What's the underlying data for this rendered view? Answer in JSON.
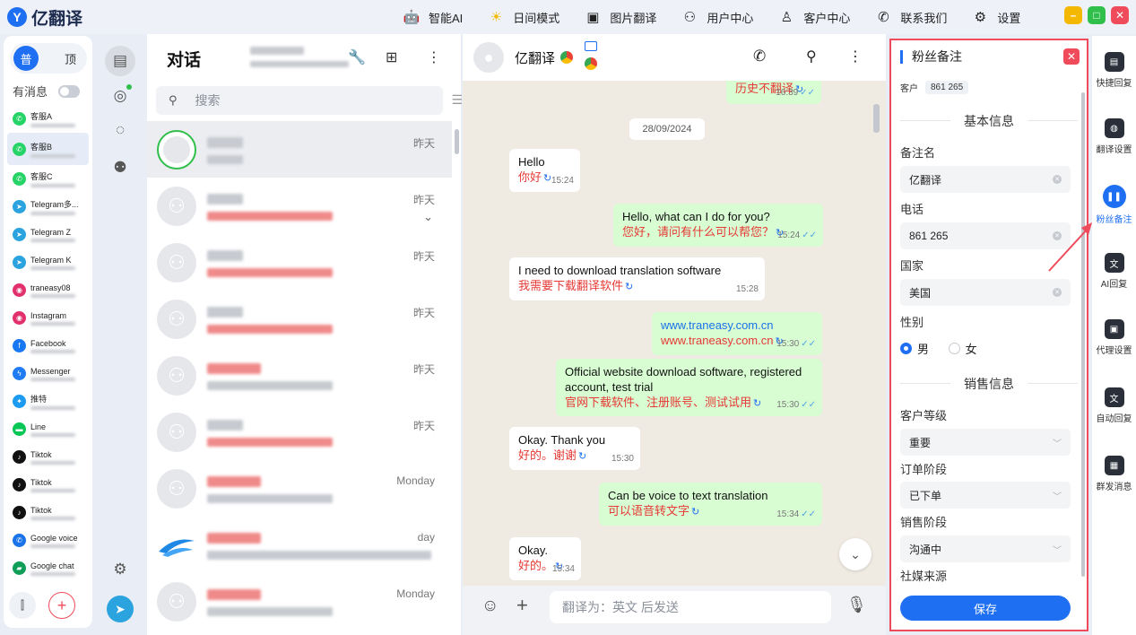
{
  "app": {
    "name": "亿翻译",
    "nav": [
      {
        "label": "智能AI",
        "icon": "robot-icon"
      },
      {
        "label": "日间模式",
        "icon": "sun-icon"
      },
      {
        "label": "图片翻译",
        "icon": "image-translate-icon"
      },
      {
        "label": "用户中心",
        "icon": "user-icon"
      },
      {
        "label": "客户中心",
        "icon": "customer-icon"
      },
      {
        "label": "联系我们",
        "icon": "phone-icon"
      },
      {
        "label": "设置",
        "icon": "gear-icon"
      }
    ]
  },
  "accounts": {
    "pin_on": "普",
    "pin_off": "顶",
    "has_msg_label": "有消息",
    "list": [
      {
        "name": "客服A",
        "icon": "whatsapp-icon",
        "color": "#25d366"
      },
      {
        "name": "客服B",
        "icon": "whatsapp-icon",
        "color": "#25d366",
        "active": true
      },
      {
        "name": "客服C",
        "icon": "whatsapp-icon",
        "color": "#25d366"
      },
      {
        "name": "Telegram多...",
        "icon": "telegram-icon",
        "color": "#2aa3df"
      },
      {
        "name": "Telegram Z",
        "icon": "telegram-icon",
        "color": "#2aa3df"
      },
      {
        "name": "Telegram K",
        "icon": "telegram-icon",
        "color": "#2aa3df"
      },
      {
        "name": "traneasy08",
        "icon": "instagram-icon",
        "color": "#e1306c"
      },
      {
        "name": "Instagram",
        "icon": "instagram-icon",
        "color": "#e1306c"
      },
      {
        "name": "Facebook",
        "icon": "facebook-icon",
        "color": "#1877f2"
      },
      {
        "name": "Messenger",
        "icon": "messenger-icon",
        "color": "#1f7cf5"
      },
      {
        "name": "推特",
        "icon": "twitter-icon",
        "color": "#1d9bf0"
      },
      {
        "name": "Line",
        "icon": "line-icon",
        "color": "#06c755"
      },
      {
        "name": "Tiktok",
        "icon": "tiktok-icon",
        "color": "#111111"
      },
      {
        "name": "Tiktok",
        "icon": "tiktok-icon",
        "color": "#111111"
      },
      {
        "name": "Tiktok",
        "icon": "tiktok-icon",
        "color": "#111111"
      },
      {
        "name": "Google voice",
        "icon": "google-voice-icon",
        "color": "#1a73e8"
      },
      {
        "name": "Google chat",
        "icon": "google-chat-icon",
        "color": "#0f9d58"
      }
    ]
  },
  "conversations": {
    "title": "对话",
    "search_placeholder": "搜索",
    "items": [
      {
        "time": "昨天",
        "selected": true
      },
      {
        "time": "昨天"
      },
      {
        "time": "昨天"
      },
      {
        "time": "昨天"
      },
      {
        "time": "昨天"
      },
      {
        "time": "昨天"
      },
      {
        "time": "Monday"
      },
      {
        "time": "day"
      },
      {
        "time": "Monday"
      }
    ]
  },
  "chat": {
    "name": "亿翻译",
    "date": "28/09/2024",
    "history_note": "历史不翻译",
    "history_time": "16:39",
    "input_placeholder": "翻译为：英文 后发送",
    "messages": [
      {
        "dir": "in",
        "en": "Hello",
        "zh": "你好",
        "time": "15:24"
      },
      {
        "dir": "out",
        "en": "Hello, what can I do for you?",
        "zh": "您好，请问有什么可以帮您？",
        "time": "15:24"
      },
      {
        "dir": "in",
        "en": "I need to download translation software",
        "zh": "我需要下载翻译软件",
        "time": "15:28"
      },
      {
        "dir": "out",
        "en": "www.traneasy.com.cn",
        "zh": "www.traneasy.com.cn",
        "time": "15:30"
      },
      {
        "dir": "out",
        "en": "Official website download software, registered account, test trial",
        "zh": "官网下载软件、注册账号、测试试用",
        "time": "15:30"
      },
      {
        "dir": "in",
        "en": "Okay. Thank you",
        "zh": "好的。谢谢",
        "time": "15:30"
      },
      {
        "dir": "out",
        "en": "Can be voice to text translation",
        "zh": "可以语音转文字",
        "time": "15:34"
      },
      {
        "dir": "in",
        "en": "Okay.",
        "zh": "好的。",
        "time": "15:34"
      }
    ]
  },
  "notes": {
    "title": "粉丝备注",
    "customer_label": "客户",
    "customer_value": "861         265",
    "basic_section": "基本信息",
    "remark_label": "备注名",
    "remark_value": "亿翻译",
    "phone_label": "电话",
    "phone_value": "861          265",
    "country_label": "国家",
    "country_value": "美国",
    "gender_label": "性别",
    "gender_male": "男",
    "gender_female": "女",
    "sales_section": "销售信息",
    "level_label": "客户等级",
    "level_value": "重要",
    "order_label": "订单阶段",
    "order_value": "已下单",
    "sale_label": "销售阶段",
    "sale_value": "沟通中",
    "source_label": "社媒来源",
    "save_label": "保存"
  },
  "right_toolbar": [
    {
      "label": "快捷回复",
      "icon": "quick-reply-icon"
    },
    {
      "label": "翻译设置",
      "icon": "globe-icon"
    },
    {
      "label": "粉丝备注",
      "icon": "notes-icon",
      "active": true
    },
    {
      "label": "AI回复",
      "icon": "ai-reply-icon"
    },
    {
      "label": "代理设置",
      "icon": "proxy-icon"
    },
    {
      "label": "自动回复",
      "icon": "auto-reply-icon"
    },
    {
      "label": "群发消息",
      "icon": "broadcast-icon"
    }
  ],
  "colors": {
    "accent": "#1f6ff2",
    "highlight_border": "#ef4b5a",
    "incoming_bubble": "#ffffff",
    "outgoing_bubble": "#d9fdd3",
    "translation_text": "#e53935"
  }
}
